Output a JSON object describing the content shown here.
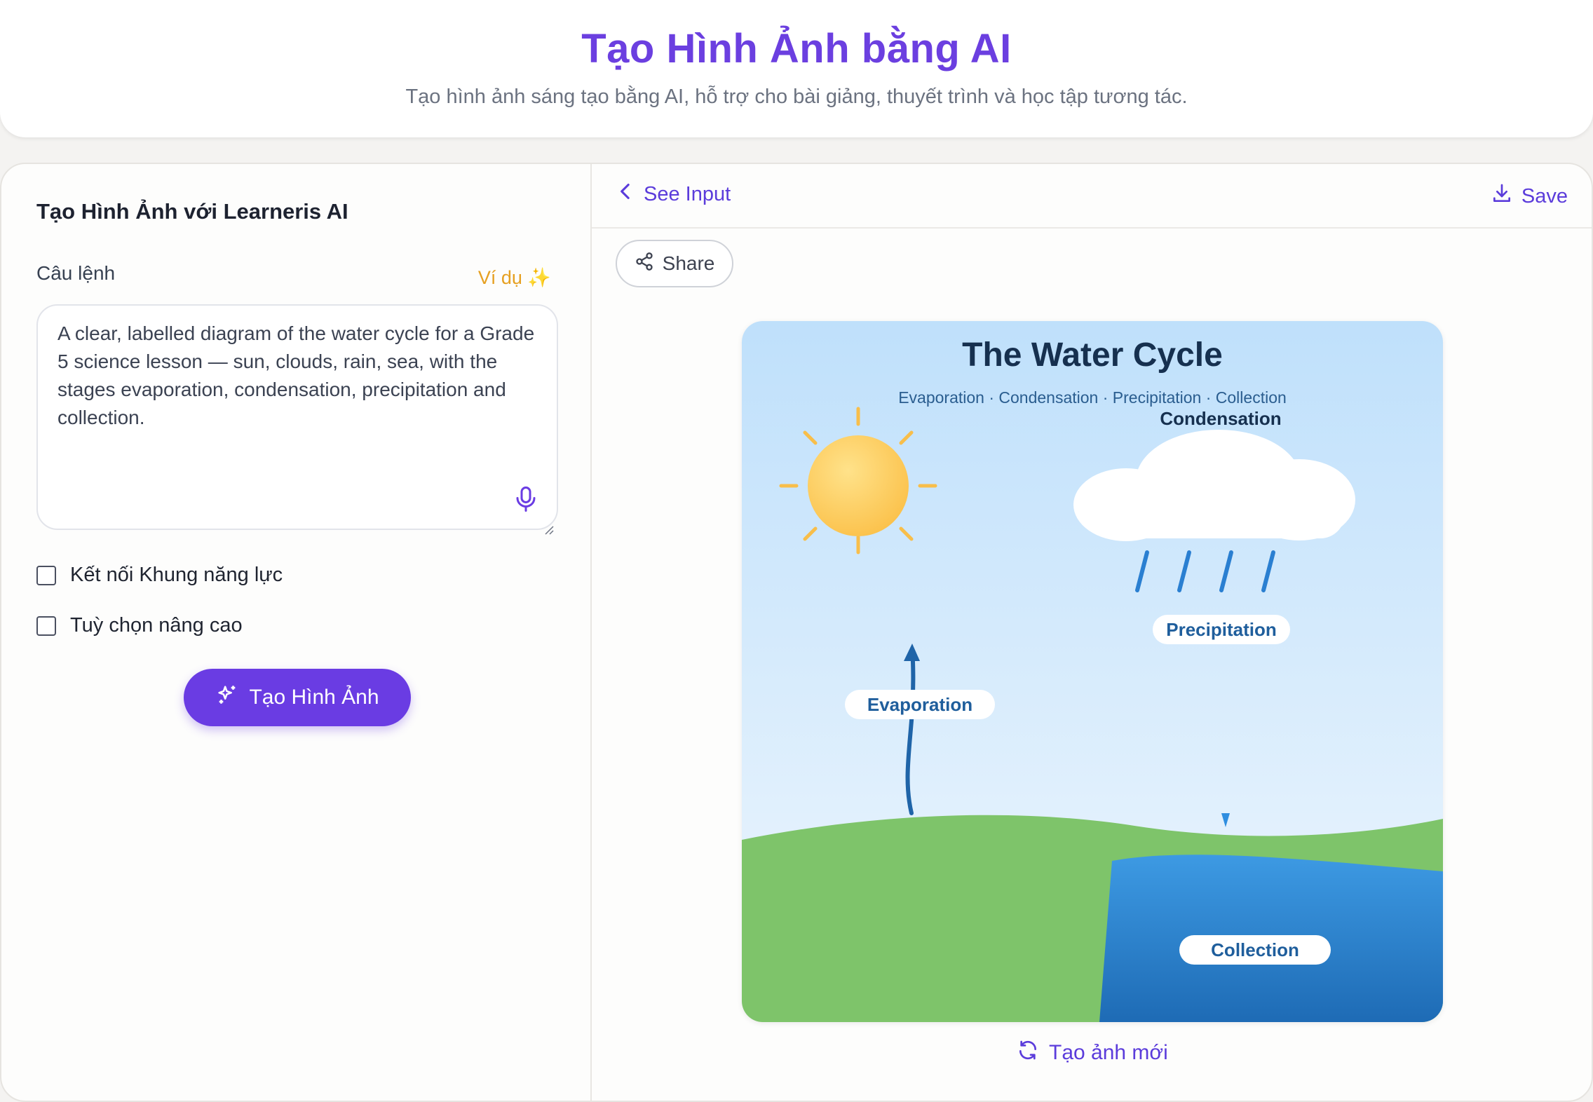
{
  "header": {
    "title": "Tạo Hình Ảnh bằng AI",
    "subtitle": "Tạo hình ảnh sáng tạo bằng AI, hỗ trợ cho bài giảng, thuyết trình và học tập tương tác."
  },
  "form": {
    "panel_title": "Tạo Hình Ảnh với Learneris AI",
    "prompt_label": "Câu lệnh",
    "example_link": "Ví dụ ✨",
    "prompt_value": "A clear, labelled diagram of the water cycle for a Grade 5 science lesson — sun, clouds, rain, sea, with the stages evaporation, condensation, precipitation and collection.",
    "checkbox_competency": "Kết nối Khung năng lực",
    "checkbox_advanced": "Tuỳ chọn nâng cao",
    "generate_button": "Tạo Hình Ảnh"
  },
  "result": {
    "see_input": "See Input",
    "save": "Save",
    "share": "Share",
    "regenerate": "Tạo ảnh mới",
    "image": {
      "title": "The Water Cycle",
      "subtitle": "Evaporation · Condensation · Precipitation · Collection",
      "label_condensation": "Condensation",
      "label_precipitation": "Precipitation",
      "label_evaporation": "Evaporation",
      "label_collection": "Collection"
    }
  },
  "colors": {
    "accent": "#6a3ce3",
    "example": "#e6a021"
  }
}
